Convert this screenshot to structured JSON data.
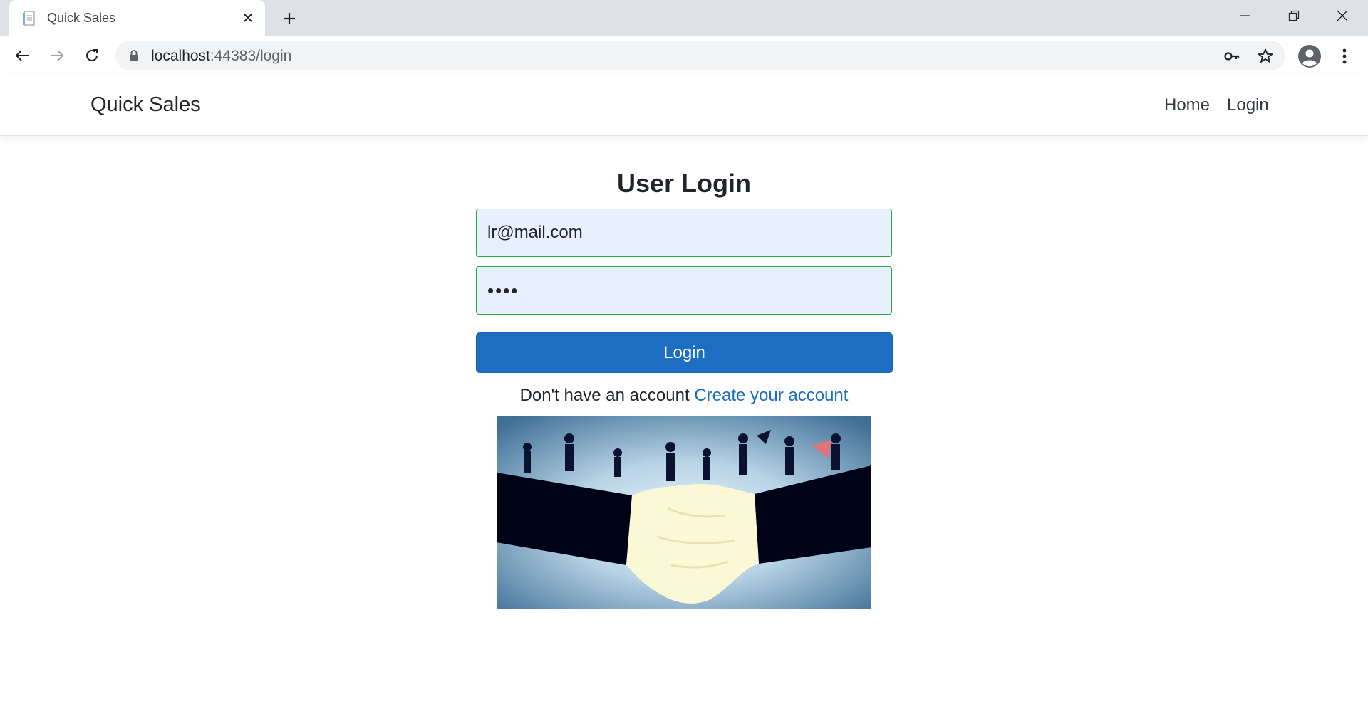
{
  "browser": {
    "tab_title": "Quick Sales",
    "url_host": "localhost",
    "url_rest": ":44383/login"
  },
  "site": {
    "brand": "Quick Sales",
    "nav": [
      {
        "label": "Home"
      },
      {
        "label": "Login"
      }
    ]
  },
  "login": {
    "title": "User Login",
    "email_value": "lr@mail.com",
    "password_value": "abcd",
    "button_label": "Login",
    "no_account_text": "Don't have an account",
    "create_account_link": "Create your account"
  },
  "colors": {
    "primary": "#1b6ec2",
    "valid_border": "#28a745",
    "autofill_bg": "#e8f0fe"
  }
}
